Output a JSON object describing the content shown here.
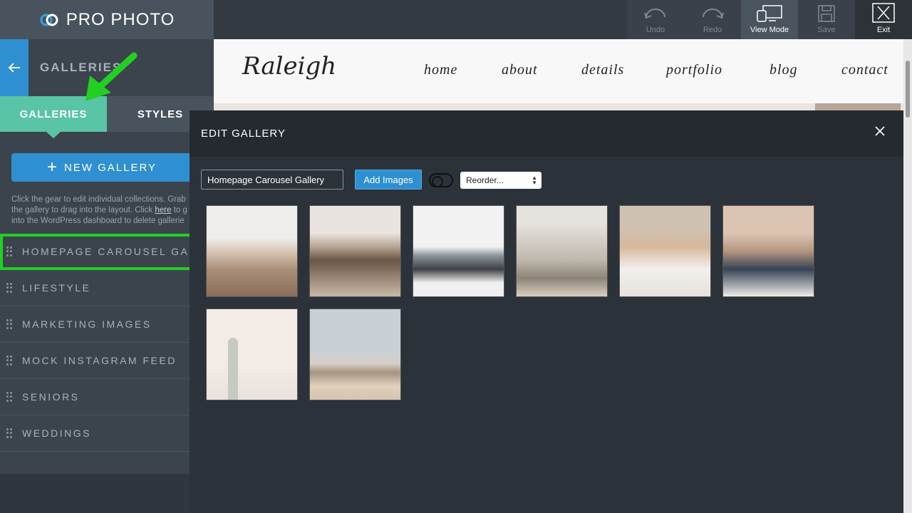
{
  "app": {
    "logo_text": "PRO PHOTO"
  },
  "toolbar": {
    "undo_label": "Undo",
    "redo_label": "Redo",
    "viewmode_label": "View Mode",
    "save_label": "Save",
    "exit_label": "Exit"
  },
  "sidebar": {
    "title": "GALLERIES",
    "tabs": [
      {
        "label": "GALLERIES"
      },
      {
        "label": "STYLES"
      }
    ],
    "new_gallery_label": "NEW GALLERY",
    "help_line1": "Click the gear to edit individual collections. Grab",
    "help_line2a": "the gallery to drag into the layout. Click ",
    "help_link": "here",
    "help_line2b": " to g",
    "help_line3": "into the WordPress dashboard to delete gallerie",
    "galleries": [
      {
        "label": "HOMEPAGE CAROUSEL GA..."
      },
      {
        "label": "LIFESTYLE"
      },
      {
        "label": "MARKETING IMAGES"
      },
      {
        "label": "MOCK INSTAGRAM FEED"
      },
      {
        "label": "SENIORS"
      },
      {
        "label": "WEDDINGS"
      }
    ]
  },
  "site": {
    "logo": "Raleigh",
    "nav": [
      "home",
      "about",
      "details",
      "portfolio",
      "blog",
      "contact"
    ]
  },
  "modal": {
    "title": "EDIT GALLERY",
    "gallery_name_value": "Homepage Carousel Gallery",
    "add_images_label": "Add Images",
    "reorder_value": "Reorder...",
    "images": [
      {
        "subject": "desert-canyon"
      },
      {
        "subject": "couple-motorcycle"
      },
      {
        "subject": "man-on-truck"
      },
      {
        "subject": "vintage-bus-couple"
      },
      {
        "subject": "man-cap-sunglasses"
      },
      {
        "subject": "couple-rocks"
      },
      {
        "subject": "saguaro-cactus"
      },
      {
        "subject": "desert-landscape"
      }
    ]
  },
  "colors": {
    "accent_blue": "#2e90d0",
    "tab_active": "#5ac4a6",
    "highlight_green": "#22d022"
  }
}
